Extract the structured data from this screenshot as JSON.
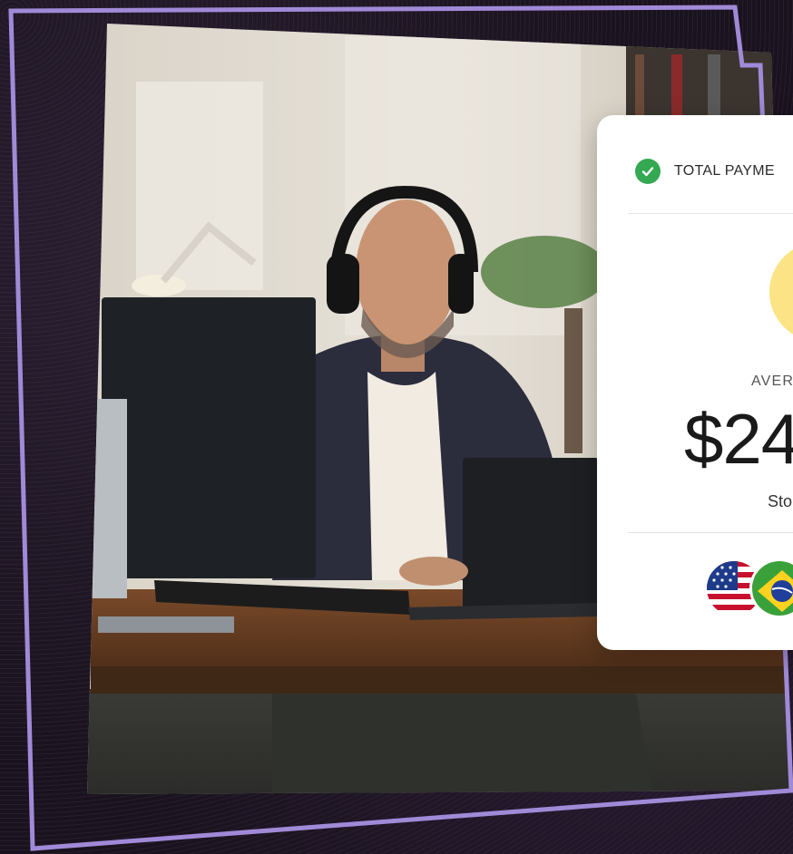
{
  "card": {
    "header_label": "TOTAL PAYME",
    "average_label": "AVER",
    "amount": "$24",
    "sub_label": "Sto"
  },
  "flags": [
    "us-flag",
    "brazil-flag"
  ],
  "colors": {
    "frame_outline": "#a08ad8",
    "check_green": "#34a853",
    "accent_circle": "#fce385",
    "card_bg": "#ffffff"
  },
  "photo": {
    "subject": "man-with-headphones-at-desk"
  }
}
